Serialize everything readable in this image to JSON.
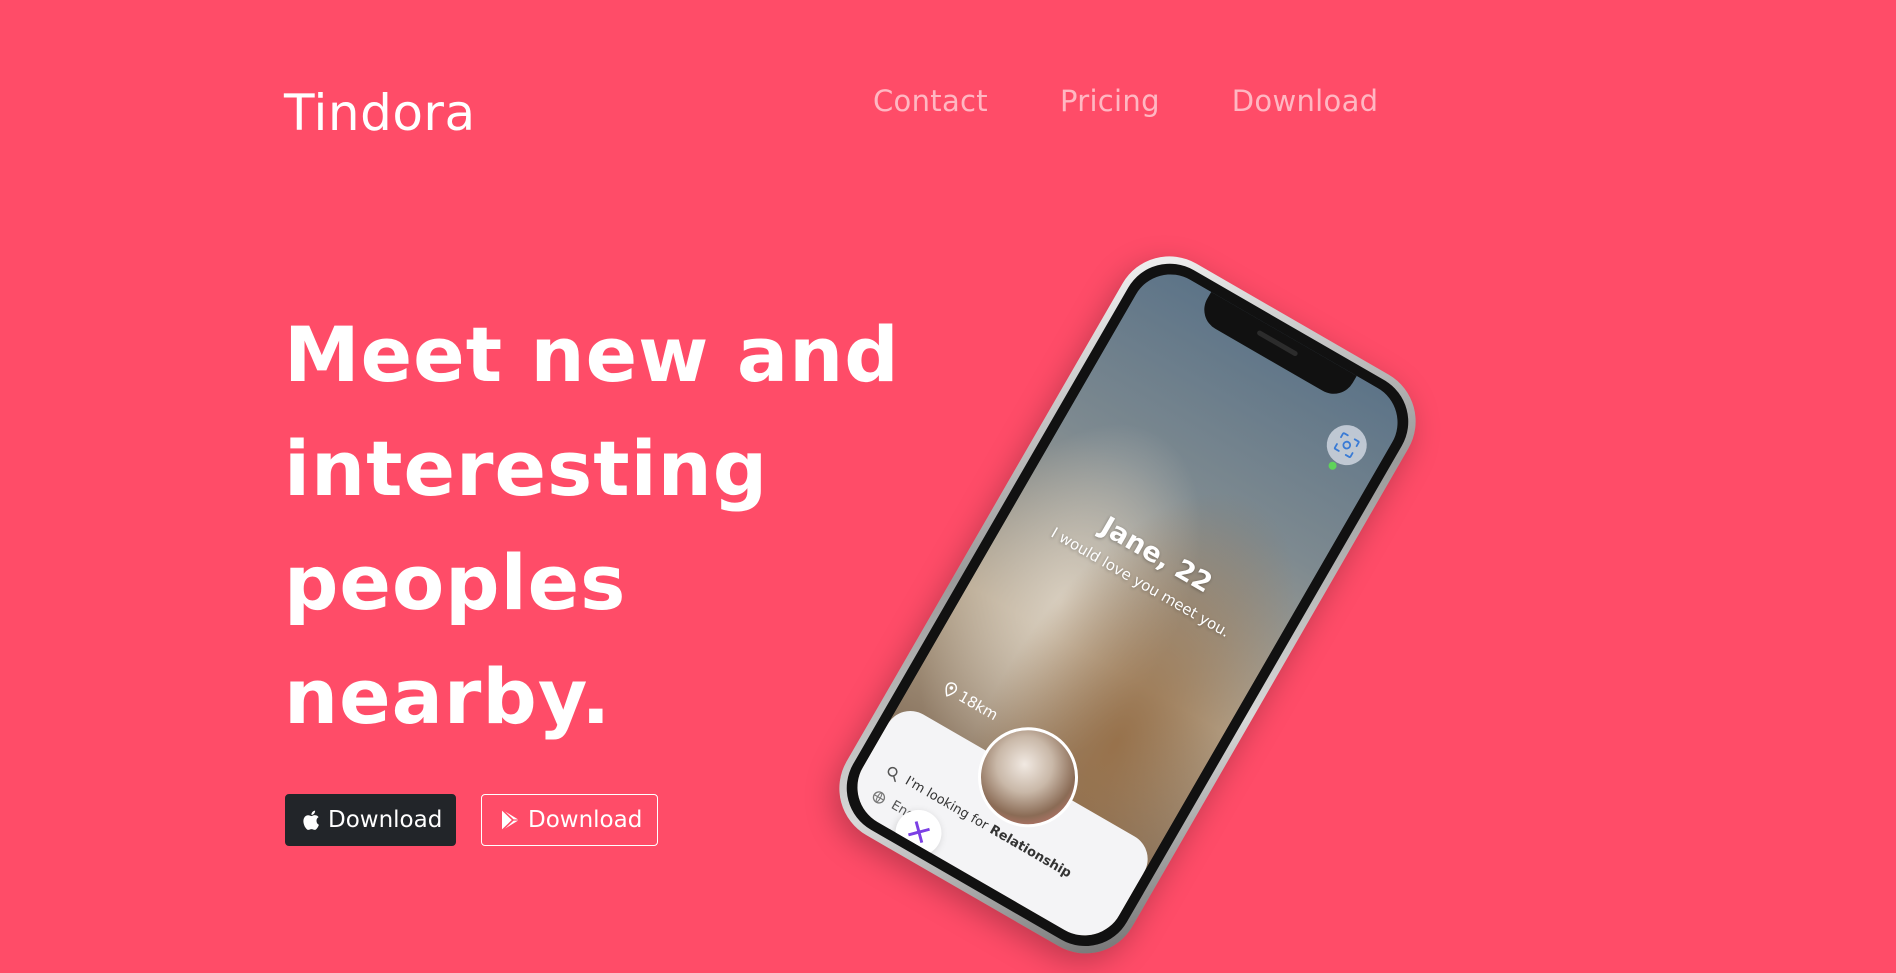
{
  "brand": {
    "name": "Tindora"
  },
  "nav": {
    "items": [
      {
        "label": "Contact"
      },
      {
        "label": "Pricing"
      },
      {
        "label": "Download"
      }
    ]
  },
  "hero": {
    "title_lines": [
      "Meet new and",
      "interesting",
      "peoples",
      "nearby."
    ],
    "buttons": {
      "apple_label": "Download",
      "play_label": "Download"
    }
  },
  "phone": {
    "profile_name": "Jane, 22",
    "profile_bio": "I would love you meet you.",
    "distance": "18km",
    "looking_for_prefix": "I'm looking for ",
    "looking_for_value": "Relationship",
    "language": "English"
  },
  "colors": {
    "background": "#ff4c68",
    "dark_button": "#222529",
    "accent_purple": "#7b3fe4"
  }
}
